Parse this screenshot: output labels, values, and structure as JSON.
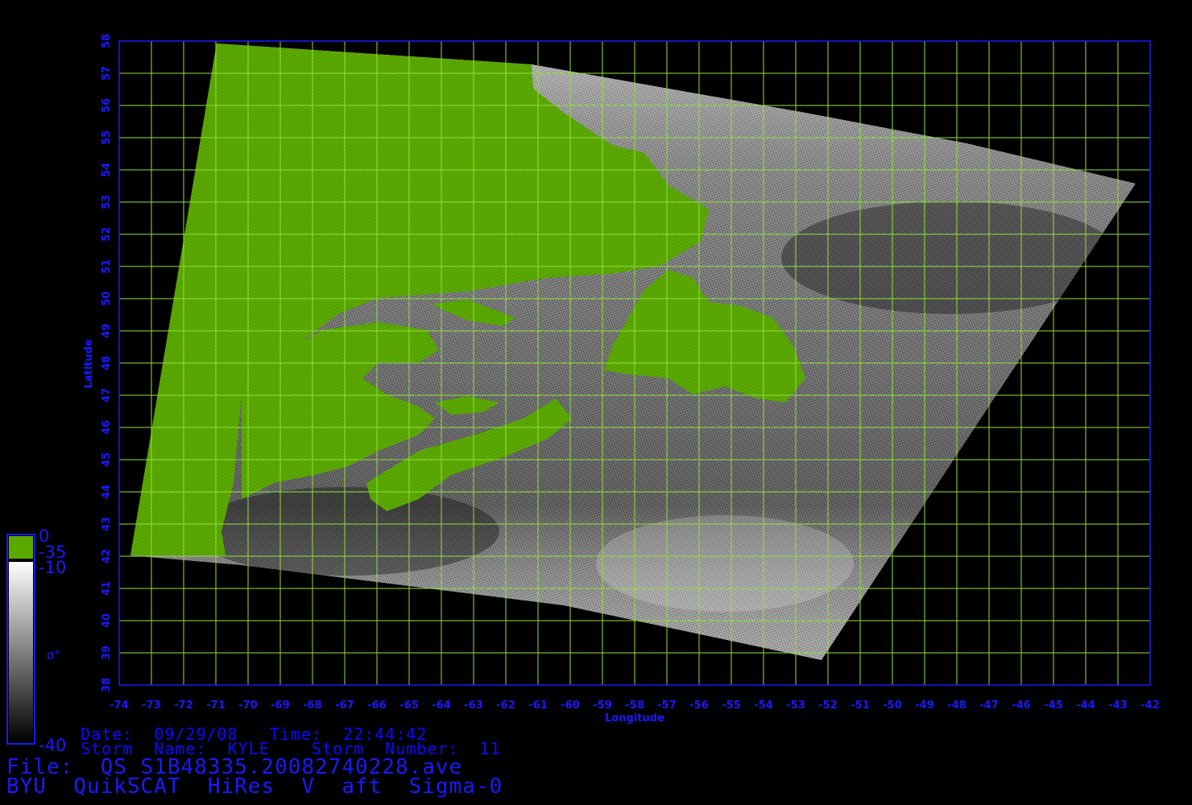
{
  "title": "BYU  QuikSCAT  HiRes  V  aft  Sigma-0",
  "file_line": "File:  QS_S1B48335.20082740228.ave",
  "date_line": "Date:  09/29/08   Time:  22:44:42",
  "storm_line": "Storm  Name:  KYLE    Storm  Number:  11",
  "xlabel": "Longitude",
  "ylabel": "Latitude",
  "lon_ticks": [
    "-74",
    "-73",
    "-72",
    "-71",
    "-70",
    "-69",
    "-68",
    "-67",
    "-66",
    "-65",
    "-64",
    "-63",
    "-62",
    "-61",
    "-60",
    "-59",
    "-58",
    "-57",
    "-56",
    "-55",
    "-54",
    "-53",
    "-52",
    "-51",
    "-50",
    "-49",
    "-48",
    "-47",
    "-46",
    "-45",
    "-44",
    "-43",
    "-42"
  ],
  "lat_ticks": [
    "38",
    "39",
    "40",
    "41",
    "42",
    "43",
    "44",
    "45",
    "46",
    "47",
    "48",
    "49",
    "50",
    "51",
    "52",
    "53",
    "54",
    "55",
    "56",
    "57",
    "58"
  ],
  "colorbar": {
    "land_top": "0",
    "land_bottom": "-35",
    "ocean_top": "-10",
    "ocean_bottom": "-40",
    "symbol": "σ°",
    "land_color": "#5aa800",
    "ocean_top_color": "#ffffff",
    "ocean_bottom_color": "#000000"
  },
  "colors": {
    "axis": "#1a1aff",
    "grid": "#90e040",
    "land": "#5aa800",
    "background": "#000000"
  }
}
